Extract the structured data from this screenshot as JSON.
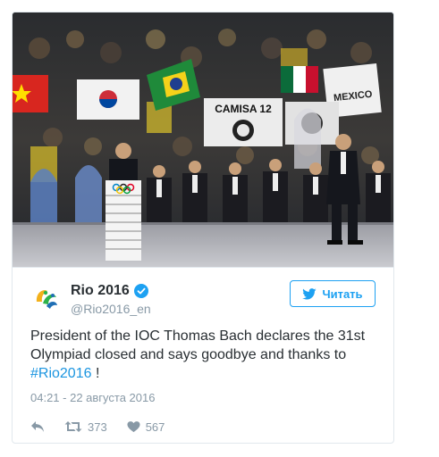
{
  "tweet": {
    "display_name": "Rio 2016",
    "username": "@Rio2016_en",
    "follow_label": "Читать",
    "text_prefix": "President of the IOC Thomas Bach declares the 31st Olympiad closed and says goodbye and thanks to ",
    "hashtag": "#Rio2016",
    "text_suffix": " !",
    "timestamp": "04:21 - 22 августа 2016",
    "retweet_count": "373",
    "like_count": "567"
  },
  "media": {
    "banner_1": "CAMISA 12",
    "banner_2": "MEXICO"
  },
  "icons": {
    "verified": "verified-badge-icon",
    "follow": "twitter-bird-icon",
    "reply": "reply-icon",
    "retweet": "retweet-icon",
    "like": "heart-icon"
  },
  "colors": {
    "accent": "#1da1f2",
    "text": "#292f33",
    "muted": "#8899a6",
    "link": "#1b95e0",
    "border": "#e1e8ed"
  }
}
